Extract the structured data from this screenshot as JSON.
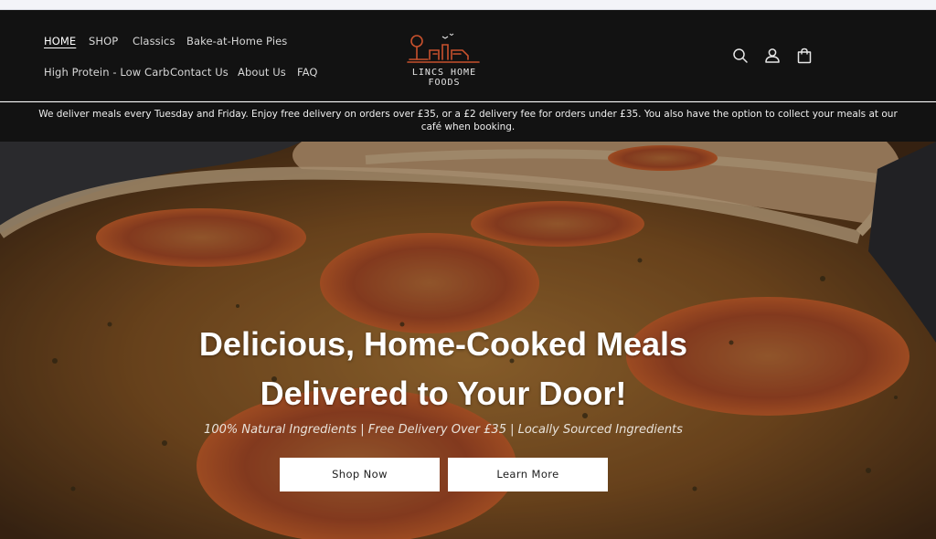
{
  "nav": {
    "items": [
      {
        "label": "HOME",
        "active": true
      },
      {
        "label": "SHOP"
      },
      {
        "label": "Classics"
      },
      {
        "label": "Bake-at-Home Pies"
      },
      {
        "label": "High Protein - Low Carb"
      },
      {
        "label": "Contact Us"
      },
      {
        "label": "About Us"
      },
      {
        "label": "FAQ"
      }
    ]
  },
  "logo": {
    "text": "LINCS HOME FOODS"
  },
  "header_icons": [
    "search-icon",
    "account-icon",
    "cart-icon"
  ],
  "announcement": {
    "text": "We deliver meals every Tuesday and Friday. Enjoy free delivery on orders over £35, or a £2 delivery fee for orders under £35. You also have the option to collect your meals at our café when booking."
  },
  "hero": {
    "title_line1": "Delicious, Home-Cooked Meals",
    "title_line2": "Delivered to Your Door!",
    "subtitle": "100% Natural Ingredients | Free Delivery Over £35 | Locally Sourced Ingredients",
    "buttons": {
      "shop_now": "Shop Now",
      "learn_more": "Learn More"
    }
  },
  "colors": {
    "header_bg": "#121212",
    "logo_accent": "#c8512d",
    "button_bg": "#ffffff"
  }
}
